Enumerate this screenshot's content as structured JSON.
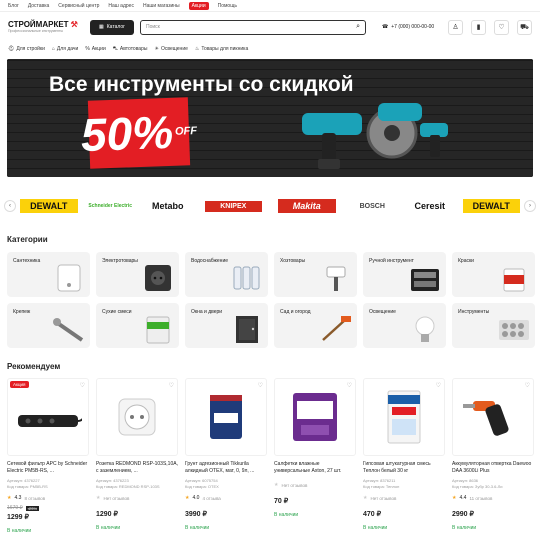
{
  "topbar": {
    "items": [
      "Блог",
      "Доставка",
      "Сервисный центр",
      "Наш адрес",
      "Наши магазины"
    ],
    "promo": "Акции",
    "help": "Помощь"
  },
  "header": {
    "logo": "СТРОЙМАРКЕТ",
    "logo_sub": "Профессиональные инструменты",
    "catalog": "Каталог",
    "search_placeholder": "Поиск",
    "phone": "+7 (000) 000-00-00"
  },
  "nav": [
    "Для стройки",
    "Для дачи",
    "Акции",
    "Автотовары",
    "Освещение",
    "Товары для пикника"
  ],
  "banner": {
    "title": "Все инструменты со скидкой",
    "percent": "50%",
    "off": "OFF"
  },
  "brands": [
    "DEWALT",
    "Schneider Electric",
    "Metabo",
    "KNIPEX",
    "Makita",
    "BOSCH",
    "Ceresit",
    "DEWALT"
  ],
  "categories_title": "Категории",
  "categories": [
    {
      "label": "Сантехника",
      "icon": "boiler-icon"
    },
    {
      "label": "Электротовары",
      "icon": "socket-icon"
    },
    {
      "label": "Водоснабжение",
      "icon": "filter-icon"
    },
    {
      "label": "Хозтовары",
      "icon": "brush-icon"
    },
    {
      "label": "Ручной инструмент",
      "icon": "toolbox-icon"
    },
    {
      "label": "Краски",
      "icon": "paint-bucket-icon"
    },
    {
      "label": "Крепеж",
      "icon": "screw-icon"
    },
    {
      "label": "Сухие смеси",
      "icon": "cement-bag-icon"
    },
    {
      "label": "Окна и двери",
      "icon": "door-icon"
    },
    {
      "label": "Сад и огород",
      "icon": "hoe-icon"
    },
    {
      "label": "Освещение",
      "icon": "bulb-icon"
    },
    {
      "label": "Инструменты",
      "icon": "socket-set-icon"
    }
  ],
  "recommended_title": "Рекомендуем",
  "products": [
    {
      "badge": "Акция",
      "name": "Сетевой фильтр APC by Schneider Electric PM5B-RS, ...",
      "article": "Артикул: 4376227",
      "code": "Код товара: PM5B-RS",
      "rating": "4.3",
      "reviews": "8 отзывов",
      "old_price": "1679 ₽",
      "discount": "-23%",
      "price": "1299 ₽",
      "stock": "В наличии"
    },
    {
      "badge": "",
      "name": "Розетка REDMOND RSP-103S,10А, с заземлением, ...",
      "article": "Артикул: 4376223",
      "code": "Код товара: REDMOND RSP-103S",
      "rating": "",
      "reviews": "Нет отзывов",
      "old_price": "",
      "discount": "",
      "price": "1290 ₽",
      "stock": "В наличии"
    },
    {
      "badge": "",
      "name": "Грунт адгезионный Tikkurila алкидный OTEX, мат, 0, 9л, ...",
      "article": "Артикул: 6075754",
      "code": "Код товара: OTEX",
      "rating": "4.0",
      "reviews": "4 отзыва",
      "old_price": "",
      "discount": "",
      "price": "3990 ₽",
      "stock": "В наличии"
    },
    {
      "badge": "",
      "name": "Салфетки влажные универсальные Axton, 27 шт.",
      "article": "",
      "code": "",
      "rating": "",
      "reviews": "Нет отзывов",
      "old_price": "",
      "discount": "",
      "price": "70 ₽",
      "stock": "В наличии"
    },
    {
      "badge": "",
      "name": "Гипсовая штукатурная смесь Теплон белый 30 кг",
      "article": "Артикул: 8376211",
      "code": "Код товара: Теплон",
      "rating": "",
      "reviews": "Нет отзывов",
      "old_price": "",
      "discount": "",
      "price": "470 ₽",
      "stock": "В наличии"
    },
    {
      "badge": "",
      "name": "Аккумуляторная отвертка Daewoo DAA 3600Li Plus",
      "article": "Артикул: 8636",
      "code": "Код товара: Зубр 30-3.6-Ли",
      "rating": "4.4",
      "reviews": "11 отзывов",
      "old_price": "",
      "discount": "",
      "price": "2990 ₽",
      "stock": "В наличии"
    }
  ]
}
